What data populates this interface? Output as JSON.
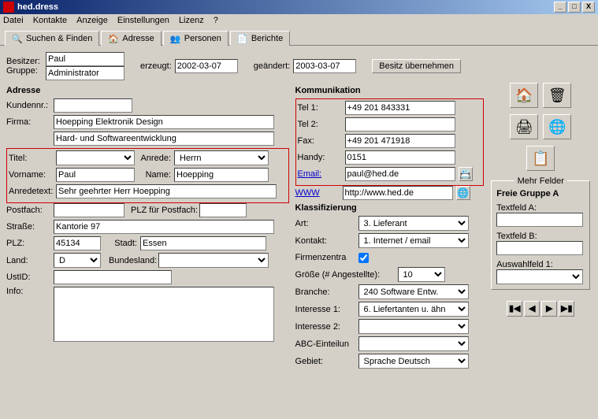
{
  "window": {
    "title": "hed.dress",
    "min": "_",
    "max": "□",
    "close": "X"
  },
  "menu": [
    "Datei",
    "Kontakte",
    "Anzeige",
    "Einstellungen",
    "Lizenz",
    "?"
  ],
  "tabs": [
    {
      "icon": "🔍",
      "label": "Suchen & Finden"
    },
    {
      "icon": "🏠",
      "label": "Adresse"
    },
    {
      "icon": "👥",
      "label": "Personen"
    },
    {
      "icon": "📄",
      "label": "Berichte"
    }
  ],
  "owner": {
    "besitzer_lbl": "Besitzer:",
    "gruppe_lbl": "Gruppe:",
    "besitzer": "Paul",
    "gruppe": "Administrator",
    "erzeugt_lbl": "erzeugt:",
    "erzeugt": "2002-03-07",
    "geaendert_lbl": "geändert:",
    "geaendert": "2003-03-07",
    "takeover": "Besitz übernehmen"
  },
  "adresse": {
    "head": "Adresse",
    "kundennr_lbl": "Kundennr.:",
    "kundennr": "",
    "firma_lbl": "Firma:",
    "firma": "Hoepping Elektronik Design",
    "firma2": "Hard- und Softwareentwicklung",
    "titel_lbl": "Titel:",
    "titel": "",
    "anrede_lbl": "Anrede:",
    "anrede": "Herrn",
    "vorname_lbl": "Vorname:",
    "vorname": "Paul",
    "name_lbl": "Name:",
    "name": "Hoepping",
    "anredetext_lbl": "Anredetext:",
    "anredetext": "Sehr geehrter Herr Hoepping",
    "postfach_lbl": "Postfach:",
    "postfach": "",
    "plz_pf_lbl": "PLZ für Postfach:",
    "plz_pf": "",
    "strasse_lbl": "Straße:",
    "strasse": "Kantorie 97",
    "plz_lbl": "PLZ:",
    "plz": "45134",
    "stadt_lbl": "Stadt:",
    "stadt": "Essen",
    "land_lbl": "Land:",
    "land": "D",
    "bundesland_lbl": "Bundesland:",
    "bundesland": "",
    "ustid_lbl": "UstID:",
    "ustid": "",
    "info_lbl": "Info:",
    "info": ""
  },
  "komm": {
    "head": "Kommunikation",
    "tel1_lbl": "Tel 1:",
    "tel1": "+49 201 843331",
    "tel2_lbl": "Tel 2:",
    "tel2": "",
    "fax_lbl": "Fax:",
    "fax": "+49 201 471918",
    "handy_lbl": "Handy:",
    "handy": "0151",
    "email_lbl": "Email:",
    "email": "paul@hed.de",
    "www_lbl": "WWW",
    "www": "http://www.hed.de"
  },
  "klass": {
    "head": "Klassifizierung",
    "art_lbl": "Art:",
    "art": "3. Lieferant",
    "kontakt_lbl": "Kontakt:",
    "kontakt": "1. Internet / email",
    "firmenzentrale_lbl": "Firmenzentra",
    "groesse_lbl": "Größe (# Angestellte):",
    "groesse": "10",
    "branche_lbl": "Branche:",
    "branche": "240 Software Entw.",
    "interesse1_lbl": "Interesse 1:",
    "interesse1": "6. Liefertanten u. ähn",
    "interesse2_lbl": "Interesse 2:",
    "interesse2": "",
    "abc_lbl": "ABC-Einteilun",
    "abc": "",
    "gebiet_lbl": "Gebiet:",
    "gebiet": "Sprache Deutsch"
  },
  "extra": {
    "mehr_felder": "Mehr Felder",
    "gruppe_a": "Freie Gruppe A",
    "textfeld_a": "Textfeld A:",
    "textfeld_b": "Textfeld B:",
    "auswahlfeld1": "Auswahlfeld 1:"
  },
  "icons": {
    "home": "🏠",
    "trash": "🗑",
    "print": "🖨",
    "globe": "🌐",
    "copy": "📋",
    "card": "📇",
    "world": "🌐"
  },
  "nav": {
    "first": "▮◀",
    "prev": "◀",
    "next": "▶",
    "last": "▶▮"
  }
}
